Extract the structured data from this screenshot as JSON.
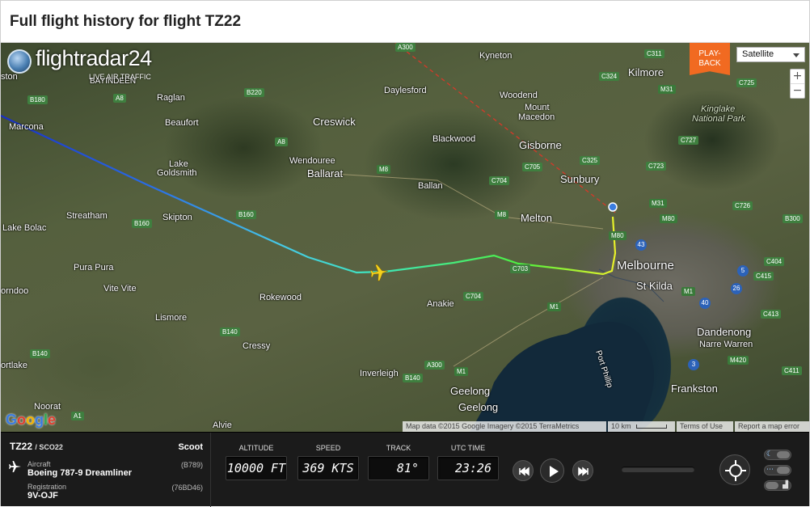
{
  "page": {
    "title": "Full flight history for flight TZ22"
  },
  "logo": {
    "brand": "flightradar24",
    "tagline": "LIVE AIR TRAFFIC"
  },
  "map": {
    "playback_label_1": "PLAY-",
    "playback_label_2": "BACK",
    "map_type": "Satellite",
    "zoom_in": "+",
    "zoom_out": "−",
    "google": "Google",
    "attribution": "Map data ©2015 Google Imagery ©2015 TerraMetrics",
    "scale": "10 km",
    "terms": "Terms of Use",
    "report": "Report a map error",
    "places": {
      "kyneton": "Kyneton",
      "kilmore": "Kilmore",
      "daylesford": "Daylesford",
      "woodend": "Woodend",
      "mount_macedon_1": "Mount",
      "mount_macedon_2": "Macedon",
      "kinglake_1": "Kinglake",
      "kinglake_2": "National Park",
      "raglan": "Raglan",
      "creswick": "Creswick",
      "beaufort": "Beaufort",
      "blackwood": "Blackwood",
      "gisborne": "Gisborne",
      "sunbury": "Sunbury",
      "wendouree": "Wendouree",
      "ballarat": "Ballarat",
      "lake_goldsmith_1": "Lake",
      "lake_goldsmith_2": "Goldsmith",
      "ballan": "Ballan",
      "streatham": "Streatham",
      "skipton": "Skipton",
      "melton": "Melton",
      "lake_bolac": "Lake Bolac",
      "pura_pura": "Pura Pura",
      "melbourne": "Melbourne",
      "st_kilda": "St Kilda",
      "vite_vite": "Vite Vite",
      "rokewood": "Rokewood",
      "anakie": "Anakie",
      "lismore": "Lismore",
      "dandenong": "Dandenong",
      "cressy": "Cressy",
      "narre_warren": "Narre Warren",
      "port_phillip": "Port Phillip",
      "inverleigh": "Inverleigh",
      "frankston": "Frankston",
      "geelong_1": "Geelong",
      "geelong_2": "Geelong",
      "noorat": "Noorat",
      "alvie": "Alvie",
      "bayindeen": "BAYINDEEN",
      "marcona": "Marcona",
      "ortlake": "ortlake",
      "orndoo": "orndoo",
      "aston": "ston"
    },
    "roads": {
      "a300_top": "A300",
      "c311": "C311",
      "c324": "C324",
      "m31_top": "M31",
      "c725": "C725",
      "b180": "B180",
      "a8": "A8",
      "b220": "B220",
      "c727": "C727",
      "a8b": "A8",
      "c705": "C705",
      "c325": "C325",
      "c723": "C723",
      "m8": "M8",
      "c704": "C704",
      "m8b": "M8",
      "m31": "M31",
      "c726": "C726",
      "b160": "B160",
      "b160b": "B160",
      "m80": "M80",
      "m80b": "M80",
      "b300": "B300",
      "c703": "C703",
      "c404": "C404",
      "c415": "C415",
      "c704b": "C704",
      "m1": "M1",
      "c413": "C413",
      "b140": "B140",
      "b140b": "B140",
      "a300": "A300",
      "m420": "M420",
      "b140c": "B140",
      "a1": "A1",
      "m1b": "M1",
      "m1c": "M1",
      "c411": "C411",
      "n43": "43",
      "n5": "5",
      "n26": "26",
      "n40": "40",
      "n3": "3"
    }
  },
  "flight": {
    "number": "TZ22",
    "callsign": "/ SCO22",
    "airline": "Scoot",
    "aircraft_label": "Aircraft",
    "aircraft": "Boeing 787-9 Dreamliner",
    "aircraft_code": "(B789)",
    "registration_label": "Registration",
    "registration": "9V-OJF",
    "registration_code": "(76BD46)"
  },
  "metrics": {
    "altitude_label": "ALTITUDE",
    "altitude": "10000 FT",
    "speed_label": "SPEED",
    "speed": "369 KTS",
    "track_label": "TRACK",
    "track": "81°",
    "time_label": "UTC TIME",
    "time": "23:26"
  },
  "colors": {
    "playback": "#f16a21",
    "panel": "#1b1b1b"
  }
}
